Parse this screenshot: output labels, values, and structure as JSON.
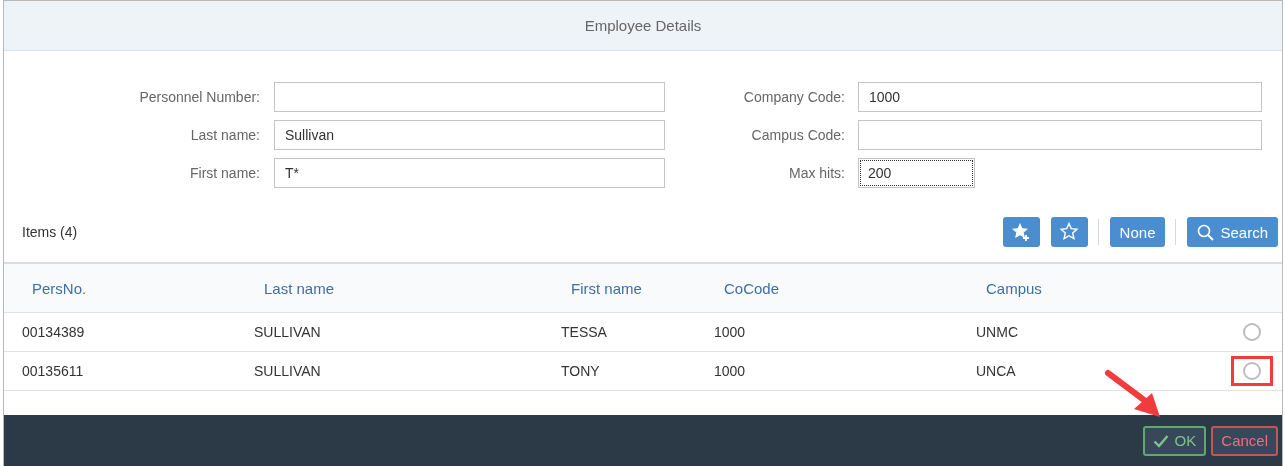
{
  "dialog": {
    "title": "Employee Details"
  },
  "form": {
    "left": [
      {
        "label": "Personnel Number:"
      },
      {
        "label": "Last name:",
        "value": "Sullivan"
      },
      {
        "label": "First name:",
        "value": "T*"
      }
    ],
    "right": [
      {
        "label": "Company Code:",
        "value": "1000",
        "kind": "wide"
      },
      {
        "label": "Campus Code:",
        "kind": "wide"
      },
      {
        "label": "Max hits:",
        "value": "200",
        "kind": "focused"
      }
    ]
  },
  "items_title": "Items (4)",
  "toolbar": [
    {
      "kind": "star-add"
    },
    {
      "kind": "star"
    },
    {
      "kind": "text",
      "label": "None"
    },
    {
      "kind": "search",
      "label": "Search"
    }
  ],
  "table": {
    "columns": [
      "PersNo.",
      "Last name",
      "First name",
      "CoCode",
      "Campus"
    ],
    "rows": [
      {
        "cells": [
          "00134389",
          "SULLIVAN",
          "TESSA",
          "1000",
          "UNMC"
        ],
        "selected": false,
        "highlighted": false
      },
      {
        "cells": [
          "00135611",
          "SULLIVAN",
          "TONY",
          "1000",
          "UNCA"
        ],
        "selected": false,
        "highlighted": true
      }
    ]
  },
  "pointer_arrow": true,
  "footer_buttons": [
    {
      "kind": "ok",
      "label": "OK"
    },
    {
      "kind": "cancel",
      "label": "Cancel"
    }
  ]
}
